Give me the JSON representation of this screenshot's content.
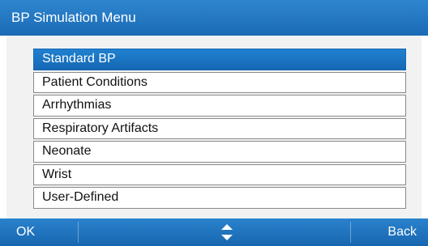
{
  "title_bar": {
    "title": "BP Simulation Menu"
  },
  "menu": {
    "selected_index": 0,
    "items": [
      {
        "label": "Standard BP"
      },
      {
        "label": "Patient Conditions"
      },
      {
        "label": "Arrhythmias"
      },
      {
        "label": "Respiratory Artifacts"
      },
      {
        "label": "Neonate"
      },
      {
        "label": "Wrist"
      },
      {
        "label": "User-Defined"
      }
    ]
  },
  "softkeys": {
    "left_label": "OK",
    "center_icon": "up-down-arrows-icon",
    "right_label": "Back"
  },
  "colors": {
    "accent": "#1a6ab5",
    "selected_item": "#1668b4",
    "panel_background": "#f2f2f2",
    "item_border": "#8a8a8a"
  }
}
